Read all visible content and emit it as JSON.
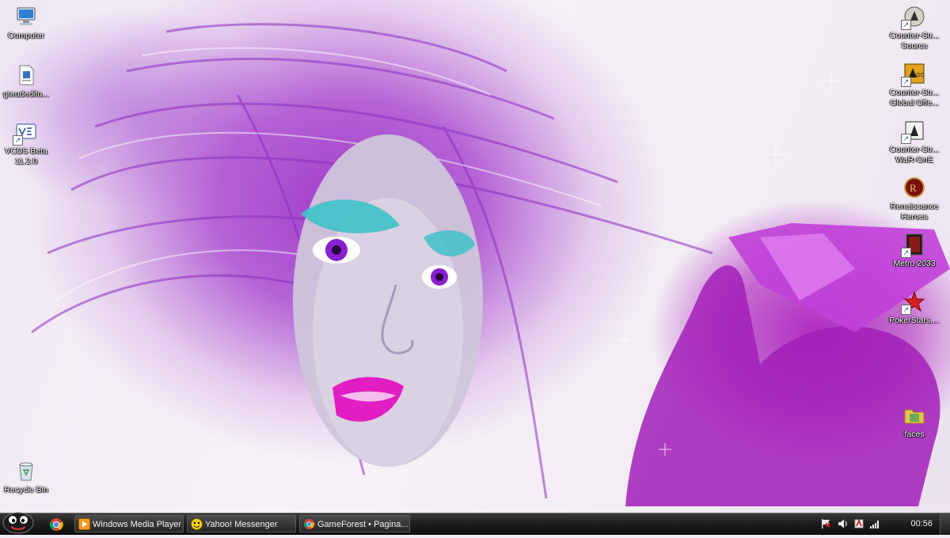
{
  "desktop": {
    "left_icons": [
      {
        "label": "Computer",
        "icon": "computer-icon"
      },
      {
        "label": "gteudedifu...",
        "icon": "document-icon"
      },
      {
        "label": "VCDS Beta 11.2.0",
        "icon": "vcds-app-icon"
      },
      {
        "label": "Recycle Bin",
        "icon": "recycle-bin-icon"
      }
    ],
    "right_icons": [
      {
        "label": "Counter-Str... Source",
        "icon": "counter-strike-source-icon"
      },
      {
        "label": "Counter-Str... Global Offe...",
        "icon": "counter-strike-go-icon"
      },
      {
        "label": "Counter-Str... WaR-OnE",
        "icon": "counter-strike-icon"
      },
      {
        "label": "Renaissance Heroes",
        "icon": "renaissance-heroes-icon"
      },
      {
        "label": "Metro 2033",
        "icon": "metro-2033-icon"
      },
      {
        "label": "PokerStars....",
        "icon": "pokerstars-icon"
      },
      {
        "label": "faces",
        "icon": "folder-icon"
      }
    ]
  },
  "taskbar": {
    "buttons": [
      {
        "label": "Windows Media Player",
        "icon": "windows-media-player-icon"
      },
      {
        "label": "Yahoo! Messenger",
        "icon": "yahoo-messenger-icon"
      },
      {
        "label": "GameForest • Pagina...",
        "icon": "chrome-icon"
      }
    ],
    "clock": "00:56"
  },
  "colors": {
    "taskbar": "#1e1e1e",
    "wallpaper_accent": "#a23bcb",
    "wallpaper_background": "#f1e9f5"
  }
}
